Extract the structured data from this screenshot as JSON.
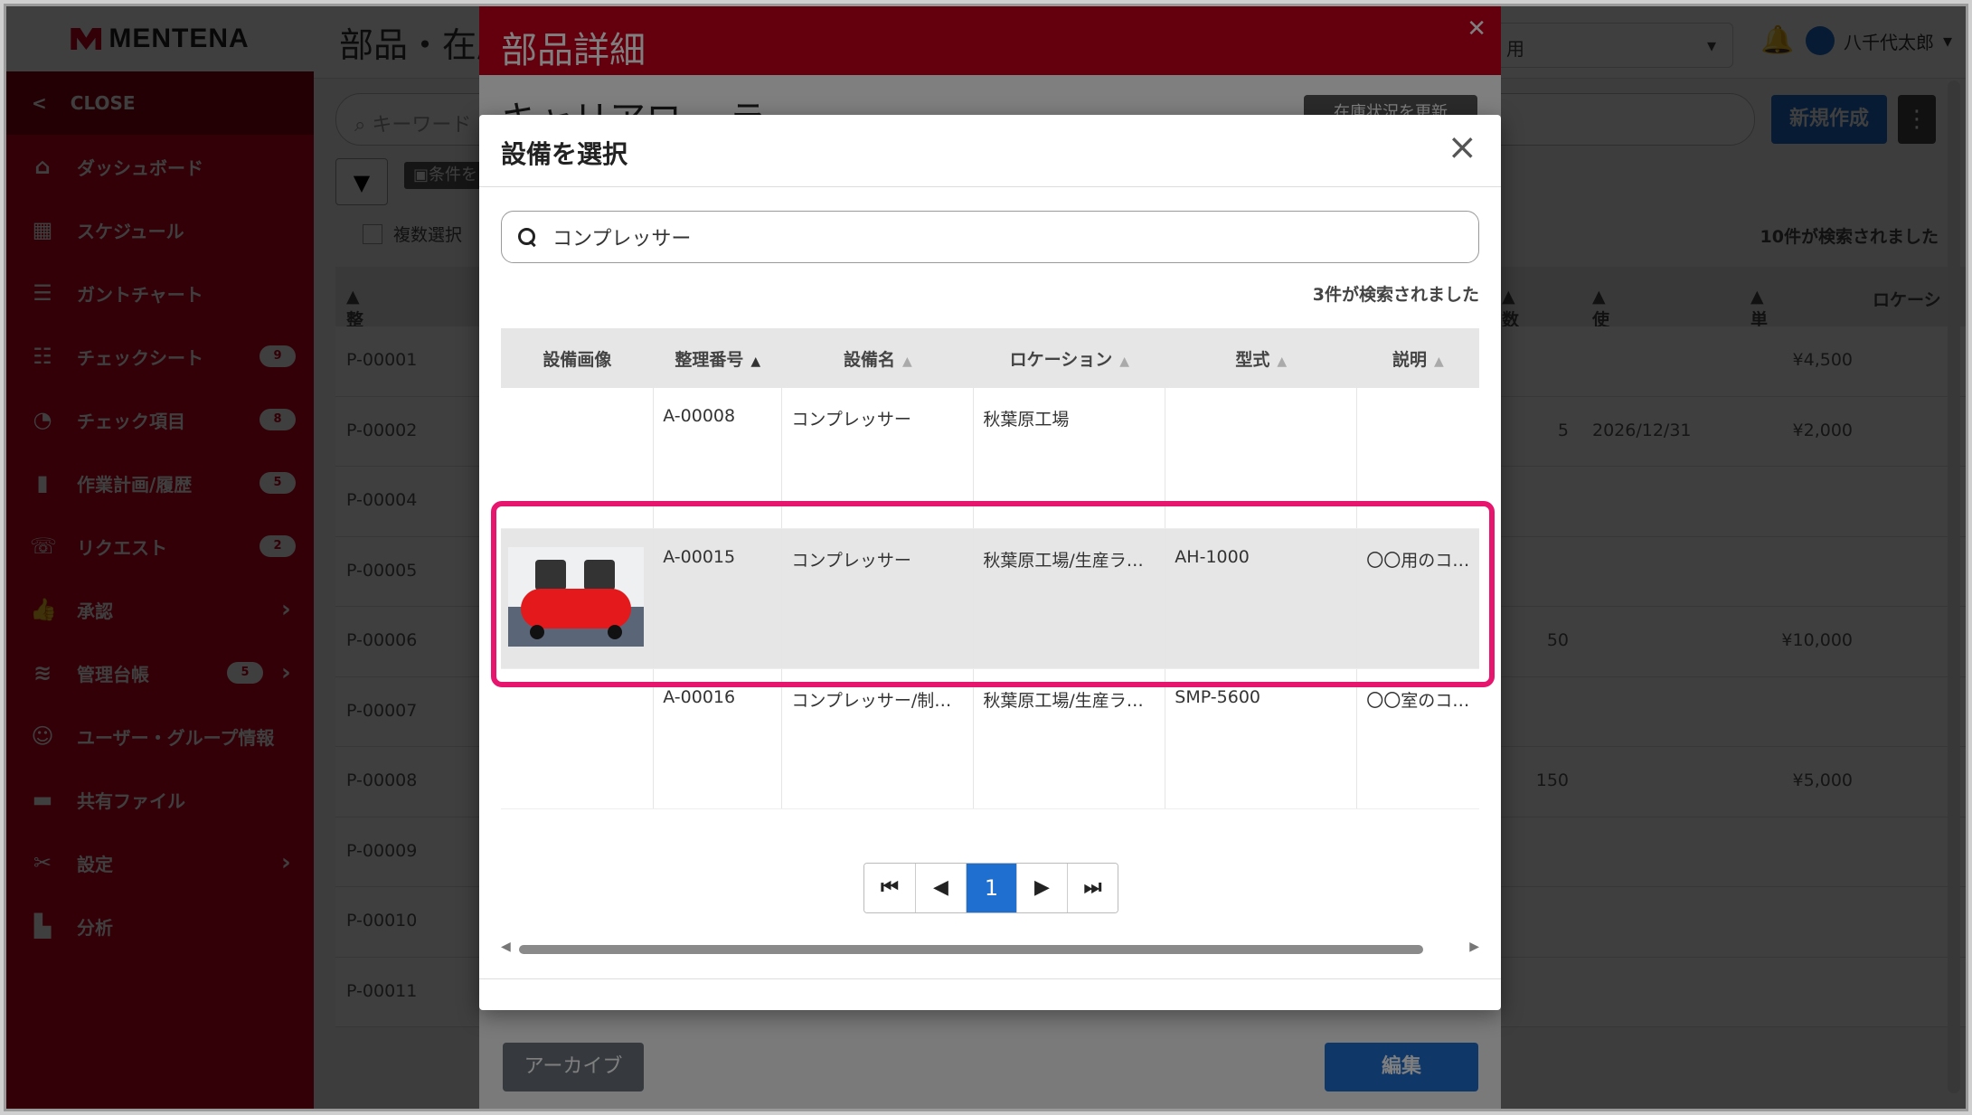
{
  "app": {
    "logo": "MENTENA",
    "page_title": "部品・在庫",
    "top_select": "用",
    "user_name": "八千代太郎",
    "close_label": "CLOSE"
  },
  "sidebar": {
    "items": [
      {
        "label": "ダッシュボード",
        "icon": "home-icon"
      },
      {
        "label": "スケジュール",
        "icon": "calendar-icon"
      },
      {
        "label": "ガントチャート",
        "icon": "bars-icon"
      },
      {
        "label": "チェックシート",
        "icon": "checklist-icon",
        "badge": "9"
      },
      {
        "label": "チェック項目",
        "icon": "gauge-icon",
        "badge": "8"
      },
      {
        "label": "作業計画/履歴",
        "icon": "clipboard-icon",
        "badge": "5"
      },
      {
        "label": "リクエスト",
        "icon": "phone-icon",
        "badge": "2"
      },
      {
        "label": "承認",
        "icon": "thumbs-up-icon",
        "chevron": true
      },
      {
        "label": "管理台帳",
        "icon": "database-icon",
        "badge": "5",
        "chevron": true
      },
      {
        "label": "ユーザー・グループ情報",
        "icon": "users-icon"
      },
      {
        "label": "共有ファイル",
        "icon": "folder-icon"
      },
      {
        "label": "設定",
        "icon": "tools-icon",
        "chevron": true
      },
      {
        "label": "分析",
        "icon": "chart-icon"
      }
    ]
  },
  "main": {
    "search_placeholder": "キーワード",
    "new_button": "新規作成",
    "save_condition": "条件を",
    "multi_select": "複数選択",
    "result_count": "10件が検索されました",
    "columns": {
      "id": "整理番号",
      "qty": "数",
      "expiry": "使用期限",
      "price": "単価",
      "location": "ロケーシ"
    },
    "rows": [
      {
        "id": "P-00001",
        "qty": "",
        "expiry": "",
        "price": "¥4,500"
      },
      {
        "id": "P-00002",
        "qty": "5",
        "expiry": "2026/12/31",
        "price": "¥2,000"
      },
      {
        "id": "P-00004",
        "qty": "",
        "expiry": "",
        "price": ""
      },
      {
        "id": "P-00005",
        "qty": "",
        "expiry": "",
        "price": ""
      },
      {
        "id": "P-00006",
        "qty": "50",
        "expiry": "",
        "price": "¥10,000"
      },
      {
        "id": "P-00007",
        "qty": "",
        "expiry": "",
        "price": ""
      },
      {
        "id": "P-00008",
        "qty": "150",
        "expiry": "",
        "price": "¥5,000"
      },
      {
        "id": "P-00009",
        "qty": "",
        "expiry": "",
        "price": ""
      },
      {
        "id": "P-00010",
        "qty": "",
        "expiry": "",
        "price": ""
      },
      {
        "id": "P-00011",
        "qty": "",
        "expiry": "",
        "price": ""
      }
    ]
  },
  "detail_modal": {
    "title": "部品詳細",
    "subtitle": "キャリアロー ラ",
    "top_button": "在庫状況を更新",
    "archive_button": "アーカイブ",
    "edit_button": "編集"
  },
  "select_modal": {
    "title": "設備を選択",
    "search_value": "コンプレッサー",
    "result_count": "3件が検索されました",
    "columns": [
      "設備画像",
      "整理番号",
      "設備名",
      "ロケーション",
      "型式",
      "説明"
    ],
    "rows": [
      {
        "image": false,
        "id": "A-00008",
        "name": "コンプレッサー",
        "location": "秋葉原工場",
        "model": "",
        "desc": ""
      },
      {
        "image": true,
        "id": "A-00015",
        "name": "コンプレッサー",
        "location": "秋葉原工場/生産ラ…",
        "model": "AH-1000",
        "desc": "〇〇用のコ…"
      },
      {
        "image": false,
        "id": "A-00016",
        "name": "コンプレッサー/制…",
        "location": "秋葉原工場/生産ラ…",
        "model": "SMP-5600",
        "desc": "〇〇室のコ…"
      }
    ],
    "pager": {
      "first": "⏮",
      "prev": "◀",
      "current": "1",
      "next": "▶",
      "last": "⏭"
    }
  },
  "colors": {
    "brand": "#c9001a",
    "primary": "#1f6fd1",
    "highlight": "#e6156e"
  }
}
